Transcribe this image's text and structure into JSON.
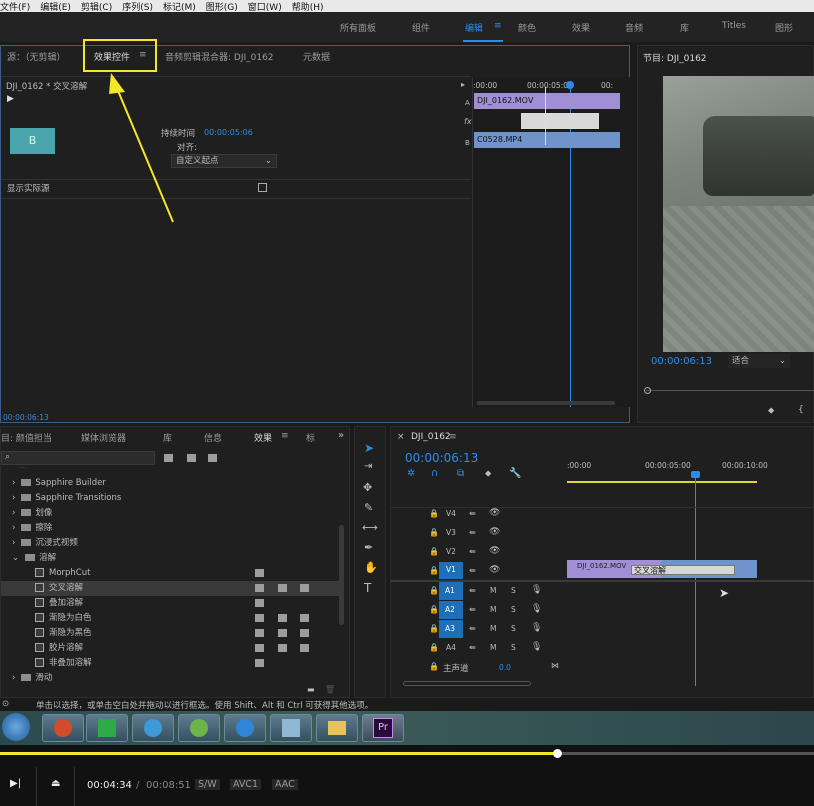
{
  "menu": [
    "文件(F)",
    "编辑(E)",
    "剪辑(C)",
    "序列(S)",
    "标记(M)",
    "图形(G)",
    "窗口(W)",
    "帮助(H)"
  ],
  "workspaces": [
    "所有面板",
    "组件",
    "编辑",
    "颜色",
    "效果",
    "音频",
    "库",
    "Titles",
    "图形"
  ],
  "source_panel": {
    "tabs": [
      "源：（无剪辑）",
      "效果控件",
      "音频剪辑混合器: DJI_0162",
      "元数据"
    ],
    "breadcrumb": "DJI_0162 * 交叉溶解",
    "duration_label": "持续时间",
    "duration_value": "00:00:05:06",
    "align_label": "对齐:",
    "align_value": "自定义起点",
    "show_sources": "显示实际源",
    "timecode": "00:00:06:13",
    "mini_times": [
      ":00:00",
      "00:00:05:00",
      "00:"
    ],
    "track_a": "A",
    "track_b": "B",
    "clip_a": "DJI_0162.MOV",
    "clip_b": "C0528.MP4",
    "fx": "fx",
    "preview_letter": "B"
  },
  "program_panel": {
    "title": "节目: DJI_0162",
    "timecode": "00:00:06:13",
    "fit_label": "适合"
  },
  "project_panel": {
    "tabs": [
      "目: 颜值担当",
      "媒体浏览器",
      "库",
      "信息",
      "效果",
      "标"
    ],
    "items": [
      {
        "label": "Sapphire Builder",
        "type": "folder"
      },
      {
        "label": "Sapphire Transitions",
        "type": "folder"
      },
      {
        "label": "划像",
        "type": "folder"
      },
      {
        "label": "擦除",
        "type": "folder"
      },
      {
        "label": "沉浸式视频",
        "type": "folder"
      },
      {
        "label": "溶解",
        "type": "folder-open"
      },
      {
        "label": "MorphCut",
        "type": "effect"
      },
      {
        "label": "交叉溶解",
        "type": "effect"
      },
      {
        "label": "叠加溶解",
        "type": "effect"
      },
      {
        "label": "渐隐为白色",
        "type": "effect"
      },
      {
        "label": "渐隐为黑色",
        "type": "effect"
      },
      {
        "label": "胶片溶解",
        "type": "effect"
      },
      {
        "label": "非叠加溶解",
        "type": "effect"
      },
      {
        "label": "滑动",
        "type": "folder"
      }
    ]
  },
  "timeline": {
    "title": "DJI_0162",
    "timecode": "00:00:06:13",
    "ruler": [
      ":00:00",
      "00:00:05:00",
      "00:00:10:00"
    ],
    "video_tracks": [
      "V4",
      "V3",
      "V2",
      "V1"
    ],
    "audio_tracks": [
      "A1",
      "A2",
      "A3",
      "A4"
    ],
    "track_m": "M",
    "track_s": "S",
    "master": "主声道",
    "master_val": "0.0",
    "clip_label": "DJI_0162.MOV",
    "transition_label": "交叉溶解"
  },
  "status_text": "单击以选择，或单击空白处并拖动以进行框选。使用 Shift、Alt 和 Ctrl 可获得其他选项。",
  "player": {
    "current": "00:04:34",
    "separator": "/",
    "total": "00:08:51",
    "tags": [
      "S/W",
      "AVC1",
      "AAC"
    ]
  },
  "colors": {
    "accent": "#2d8ceb",
    "highlight": "#f4e628"
  }
}
